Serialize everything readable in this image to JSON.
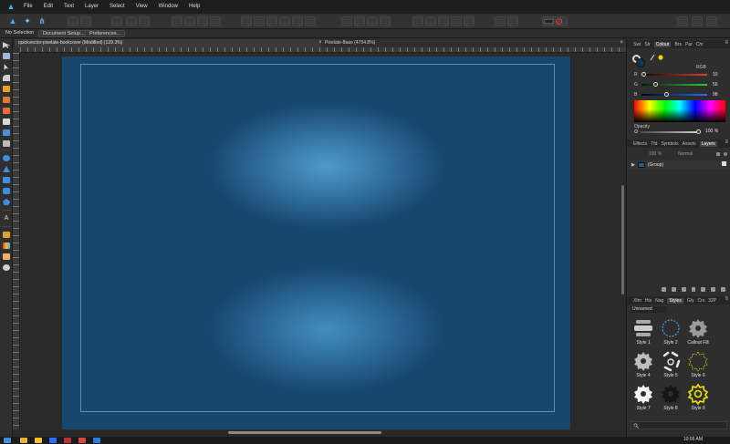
{
  "app": {
    "logo_icon": "affinity-designer-logo"
  },
  "menu": [
    "File",
    "Edit",
    "Text",
    "Layer",
    "Select",
    "View",
    "Window",
    "Help"
  ],
  "context_bar": {
    "selection_label": "No Selection",
    "document_setup_label": "Document Setup...",
    "preferences_label": "Preferences..."
  },
  "document_tabs": [
    {
      "title": "quickvector-pixelate-bookcover (Modified) (129.3%)",
      "active": true,
      "close": "×"
    },
    {
      "title": "Pixelate-Base (4754.8%)",
      "active": false,
      "close": "×"
    }
  ],
  "panels": {
    "top_tabs": [
      "Swt",
      "Str",
      "Colour",
      "Brs",
      "Par",
      "Chr"
    ],
    "top_active": "Colour",
    "colour": {
      "model": "RGB",
      "sliders": [
        {
          "letter": "R",
          "value": "10",
          "fraction": 0.04,
          "color_from": "#1a0000",
          "color_to": "#e23b3b"
        },
        {
          "letter": "G",
          "value": "56",
          "fraction": 0.22,
          "color_from": "#001a00",
          "color_to": "#2ecc40"
        },
        {
          "letter": "B",
          "value": "98",
          "fraction": 0.38,
          "color_from": "#00001a",
          "color_to": "#2f6bff"
        }
      ],
      "opacity_label": "Opacity",
      "opacity_value": "100 %",
      "main_swatch": "#0a3856"
    },
    "mid_tabs": [
      "Effects",
      "Tfd",
      "Symbols",
      "Assets",
      "Layers"
    ],
    "mid_active": "Layers",
    "layers": {
      "opacity": "100 %",
      "blend": "Normal",
      "items": [
        {
          "name": "(Group)",
          "expand": "▶"
        }
      ]
    },
    "bottom_tabs": [
      "Xfm",
      "His",
      "Nag",
      "Styles",
      "Gly",
      "Crs",
      "32P"
    ],
    "bottom_active": "Styles",
    "styles": {
      "category": "Unnamed",
      "items": [
        "Style 1",
        "Style 2",
        "Callout Fill",
        "Style 4",
        "Style 5",
        "Style 6",
        "Style 7",
        "Style 8",
        "Style 9"
      ]
    },
    "menu_glyph": "≡"
  },
  "taskbar": {
    "time": "10:06 AM"
  }
}
